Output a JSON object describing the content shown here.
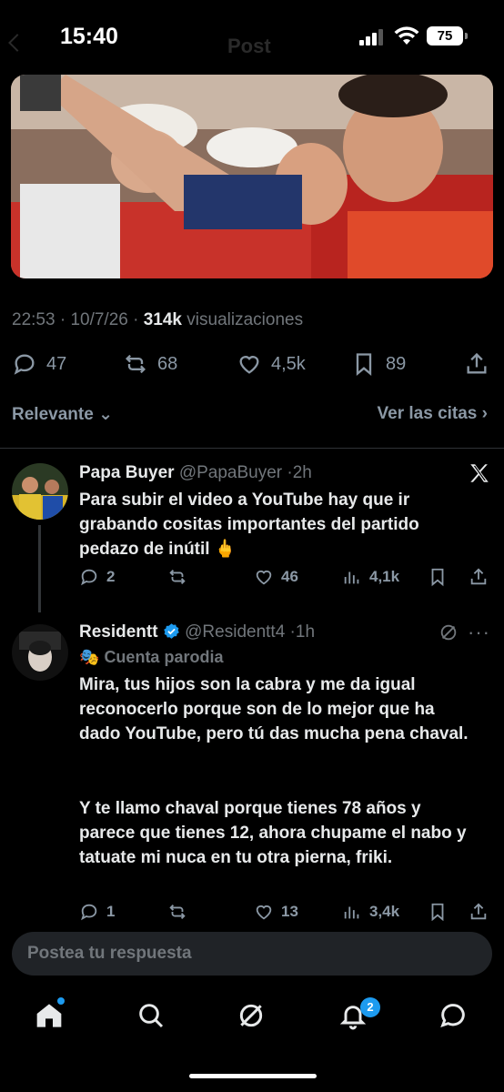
{
  "status_bar": {
    "time": "15:40",
    "battery": "75",
    "faded_title": "Post"
  },
  "tweet": {
    "time": "22:53",
    "date": "10/7/26",
    "views_count": "314k",
    "views_label": "visualizaciones",
    "replies": "47",
    "reposts": "68",
    "likes": "4,5k",
    "bookmarks": "89"
  },
  "sort": {
    "label": "Relevante",
    "quotes_label": "Ver las citas"
  },
  "replies": [
    {
      "name": "Papa Buyer",
      "handle": "@PapaBuyer",
      "time": "2h",
      "text": "Para subir el video a YouTube hay que ir grabando cositas importantes del partido pedazo de inútil 🖕",
      "replies": "2",
      "reposts": "",
      "likes": "46",
      "views": "4,1k"
    },
    {
      "name": "Residentt",
      "handle": "@Residentt4",
      "time": "1h",
      "parody_label": "Cuenta parodia",
      "text_p1": "Mira, tus hijos son la cabra y me da igual reconocerlo porque son de lo mejor que ha dado YouTube, pero tú das mucha pena chaval.",
      "text_p2": "Y te llamo chaval porque tienes 78 años y parece que tienes 12, ahora chupame el nabo y tatuate mi nuca en tu otra pierna, friki.",
      "replies": "1",
      "reposts": "",
      "likes": "13",
      "views": "3,4k"
    }
  ],
  "compose": {
    "placeholder": "Postea tu respuesta"
  },
  "tabbar": {
    "notifications_badge": "2"
  },
  "colors": {
    "accent": "#1d9bf0",
    "background": "#000000",
    "muted": "#71767b",
    "verified": "#1d9bf0"
  }
}
